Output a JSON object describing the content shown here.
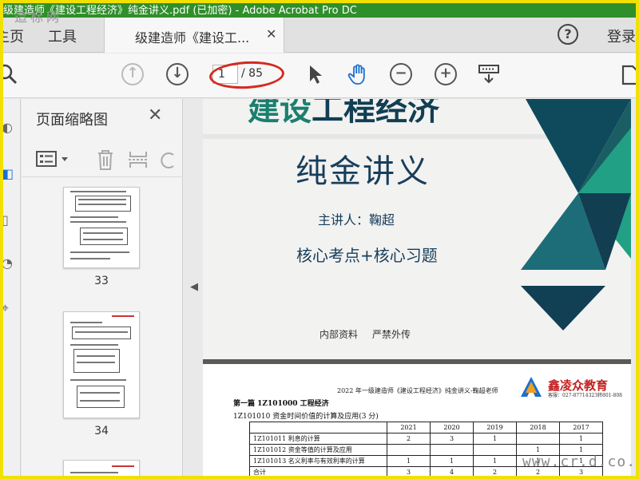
{
  "window": {
    "title": "级建造师《建设工程经济》纯金讲义.pdf (已加密) - Adobe Acrobat Pro DC"
  },
  "watermark_top": "造标网",
  "watermark_bottom": "www.cr.d.co.com",
  "tabs": {
    "home": "主页",
    "tools": "工具",
    "document": "级建造师《建设工...",
    "close": "✕",
    "help": "?",
    "login": "登录"
  },
  "toolbar": {
    "current_page": "1",
    "total_pages": "/ 85"
  },
  "thumbnail_panel": {
    "title": "页面缩略图",
    "close": "✕",
    "pages": [
      "33",
      "34"
    ]
  },
  "page1": {
    "title_part1": "建设",
    "title_part2": "工程经济",
    "subtitle": "纯金讲义",
    "lecturer": "主讲人：鞠超",
    "core": "核心考点+核心习题",
    "internal": "内部资料",
    "no_distribute": "严禁外传"
  },
  "page2": {
    "header": "2022 年一级建造师《建设工程经济》纯金讲义-鞠超老师",
    "brand": "鑫凌众教育",
    "brand_sub": "客服：027-87714323转801-808",
    "heading1": "第一篇  1Z101000  工程经济",
    "heading2": "1Z101010  资金时间价值的计算及应用(3 分)",
    "table_header": [
      "",
      "2021",
      "2020",
      "2019",
      "2018",
      "2017"
    ],
    "table_rows": [
      [
        "1Z101011  利息的计算",
        "2",
        "3",
        "1",
        "",
        "1"
      ],
      [
        "1Z101012  资金等值的计算及应用",
        "",
        "",
        "",
        "1",
        "1"
      ],
      [
        "1Z101013  名义利率与有效利率的计算",
        "1",
        "1",
        "1",
        "1",
        "1"
      ],
      [
        "合计",
        "3",
        "4",
        "2",
        "2",
        "3"
      ]
    ]
  },
  "colors": {
    "accent_green": "#1b7f6f",
    "dark_navy": "#113f54",
    "annotation_red": "#d42a1f",
    "frame_yellow": "#f2e100"
  }
}
